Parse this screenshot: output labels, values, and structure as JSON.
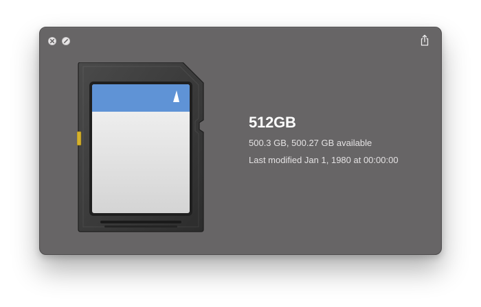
{
  "window": {
    "background_color": "#676566",
    "close_button_icon": "close-x-icon",
    "fullscreen_button_icon": "fullscreen-slash-icon",
    "share_button_icon": "share-icon"
  },
  "volume": {
    "icon": "sd-card-icon",
    "name": "512GB",
    "capacity_text": "500.3 GB, 500.27 GB available",
    "modified_text": "Last modified Jan 1, 1980 at 00:00:00",
    "label_color": "#5f93d6"
  }
}
